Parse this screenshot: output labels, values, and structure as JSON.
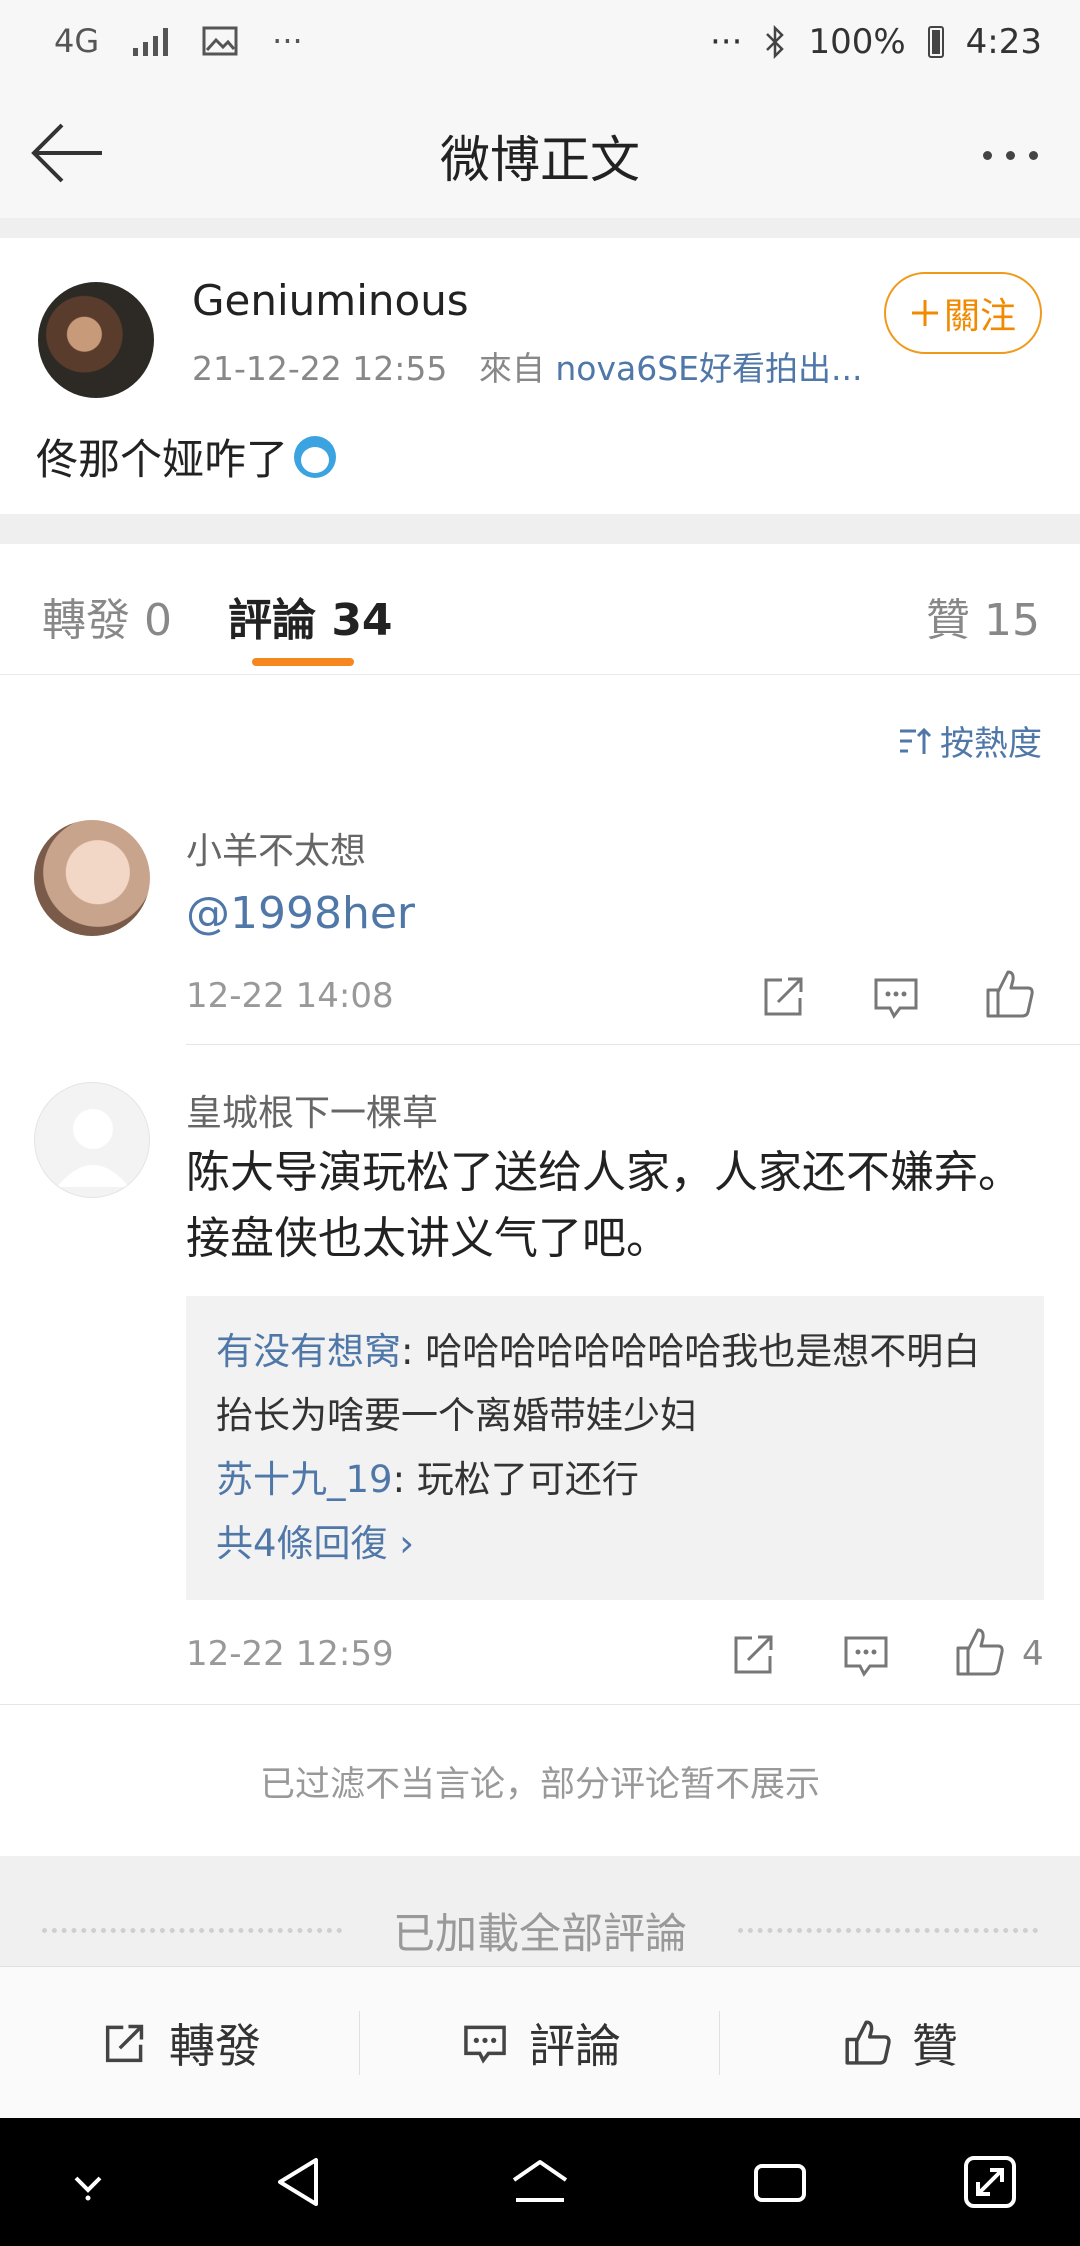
{
  "status_bar": {
    "network": "4G",
    "more_left": "···",
    "more_right": "···",
    "battery": "100%",
    "time": "4:23"
  },
  "nav": {
    "title": "微博正文"
  },
  "post": {
    "username": "Geniuminous",
    "timestamp": "21-12-22 12:55",
    "source_prefix": "來自",
    "source": "nova6SE好看拍出...",
    "follow_label": "關注",
    "text": "佟那个娅咋了"
  },
  "tabs": {
    "repost": "轉發 0",
    "comment": "評論 34",
    "like": "贊 15"
  },
  "sort_label": "按熱度",
  "comments": [
    {
      "username": "小羊不太想",
      "text": "@1998her",
      "time": "12-22 14:08"
    },
    {
      "username": "皇城根下一棵草",
      "text": "陈大导演玩松了送给人家，人家还不嫌弃。接盘侠也太讲义气了吧。",
      "time": "12-22 12:59",
      "likes": "4",
      "replies": [
        {
          "name": "有没有想窝",
          "text": ": 哈哈哈哈哈哈哈哈我也是想不明白 抬长为啥要一个离婚带娃少妇"
        },
        {
          "name": "苏十九_19",
          "text": ": 玩松了可还行"
        }
      ],
      "more_replies": "共4條回復 ›"
    }
  ],
  "filter_note": "已过滤不当言论，部分评论暂不展示",
  "end_note": "已加載全部評論",
  "bottom_bar": {
    "repost": "轉發",
    "comment": "評論",
    "like": "贊"
  }
}
